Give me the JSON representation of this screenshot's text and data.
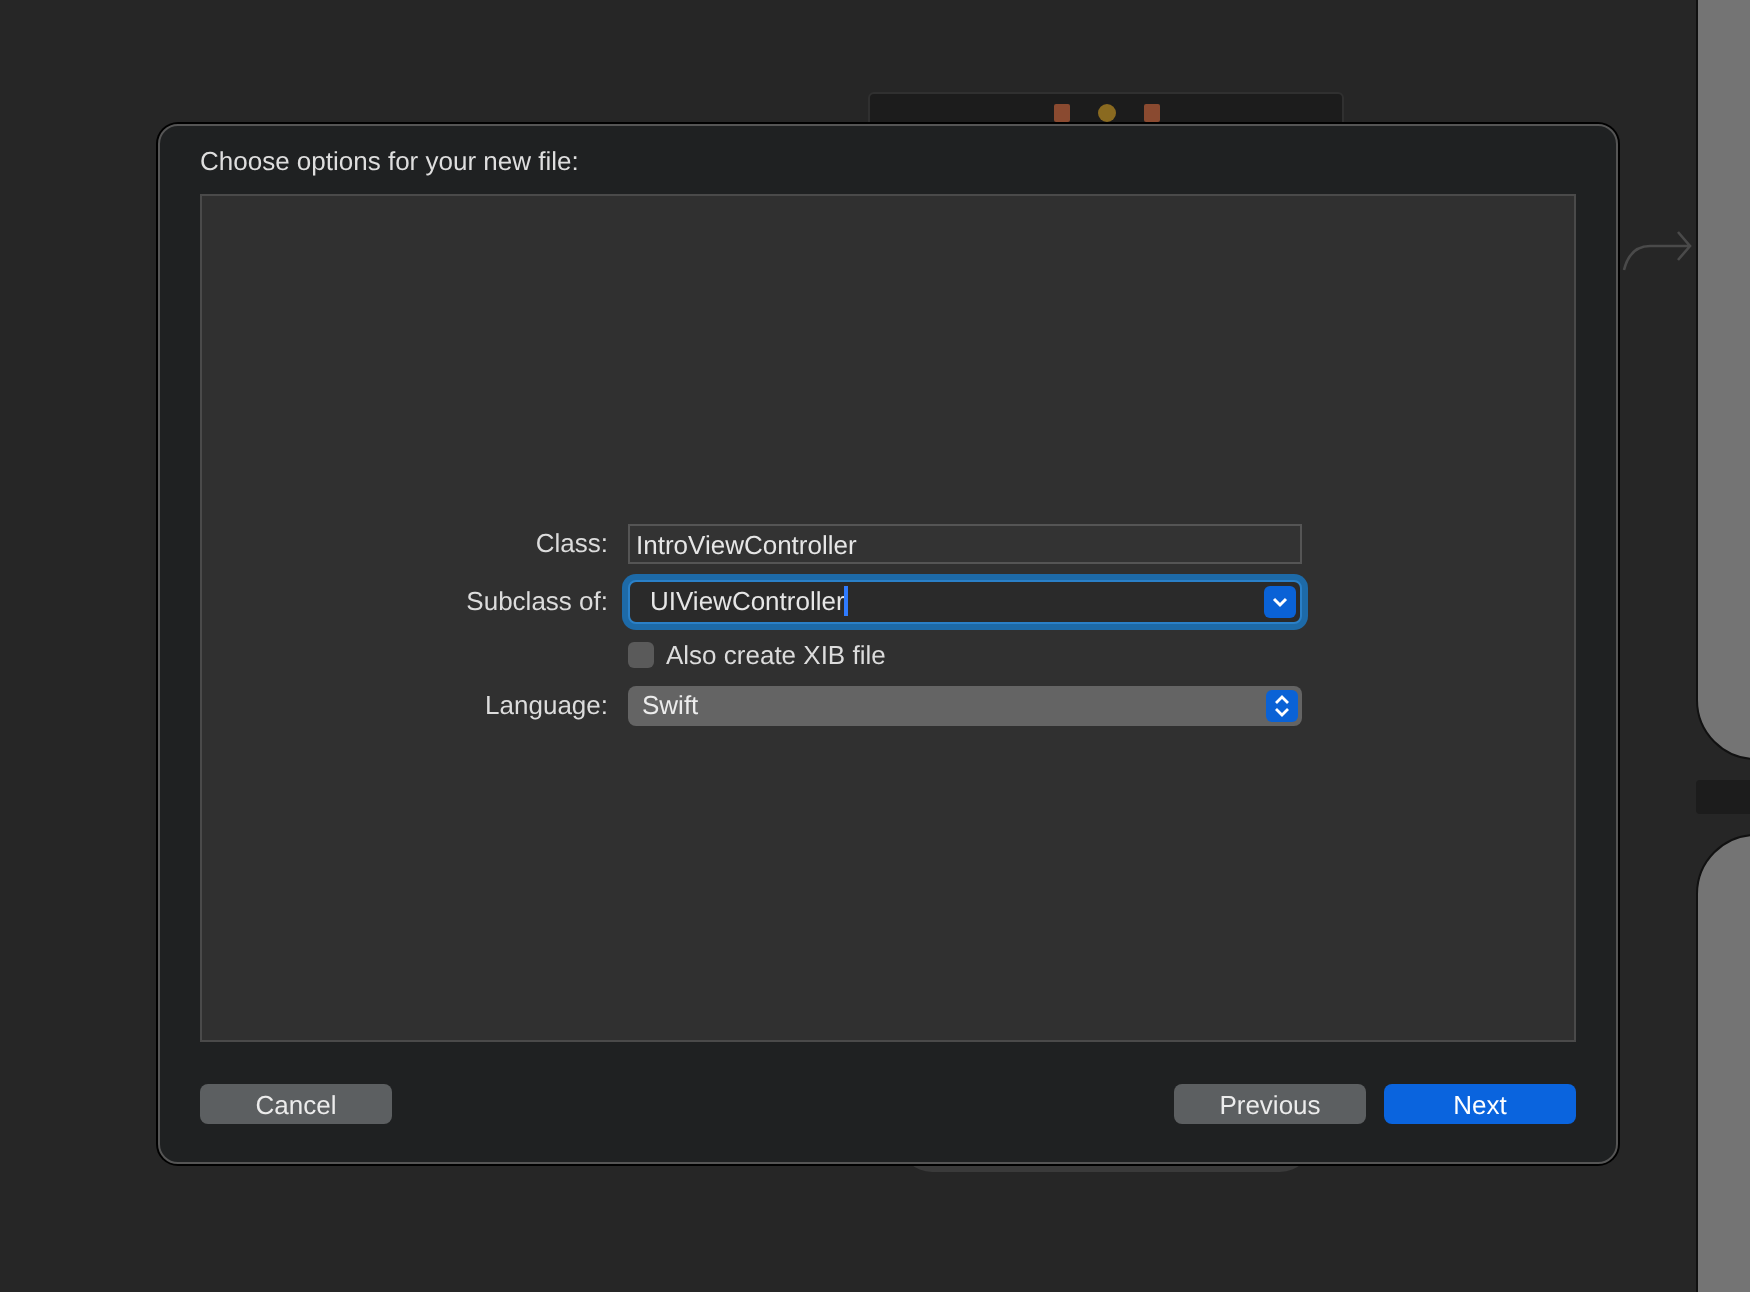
{
  "dialog": {
    "title": "Choose options for your new file:"
  },
  "fields": [
    {
      "kind": "text",
      "label": "Class:",
      "value": "IntroViewController",
      "focused": false
    },
    {
      "kind": "combo",
      "label": "Subclass of:",
      "value": "UIViewController",
      "focused": true
    },
    {
      "kind": "checkbox",
      "label": "Also create XIB file",
      "checked": false
    },
    {
      "kind": "popup",
      "label": "Language:",
      "value": "Swift",
      "focused": false
    }
  ],
  "leading_buttons": [
    {
      "label": "Cancel",
      "default": false
    }
  ],
  "trailing_buttons": [
    {
      "label": "Previous",
      "default": false
    },
    {
      "label": "Next",
      "default": true
    }
  ]
}
